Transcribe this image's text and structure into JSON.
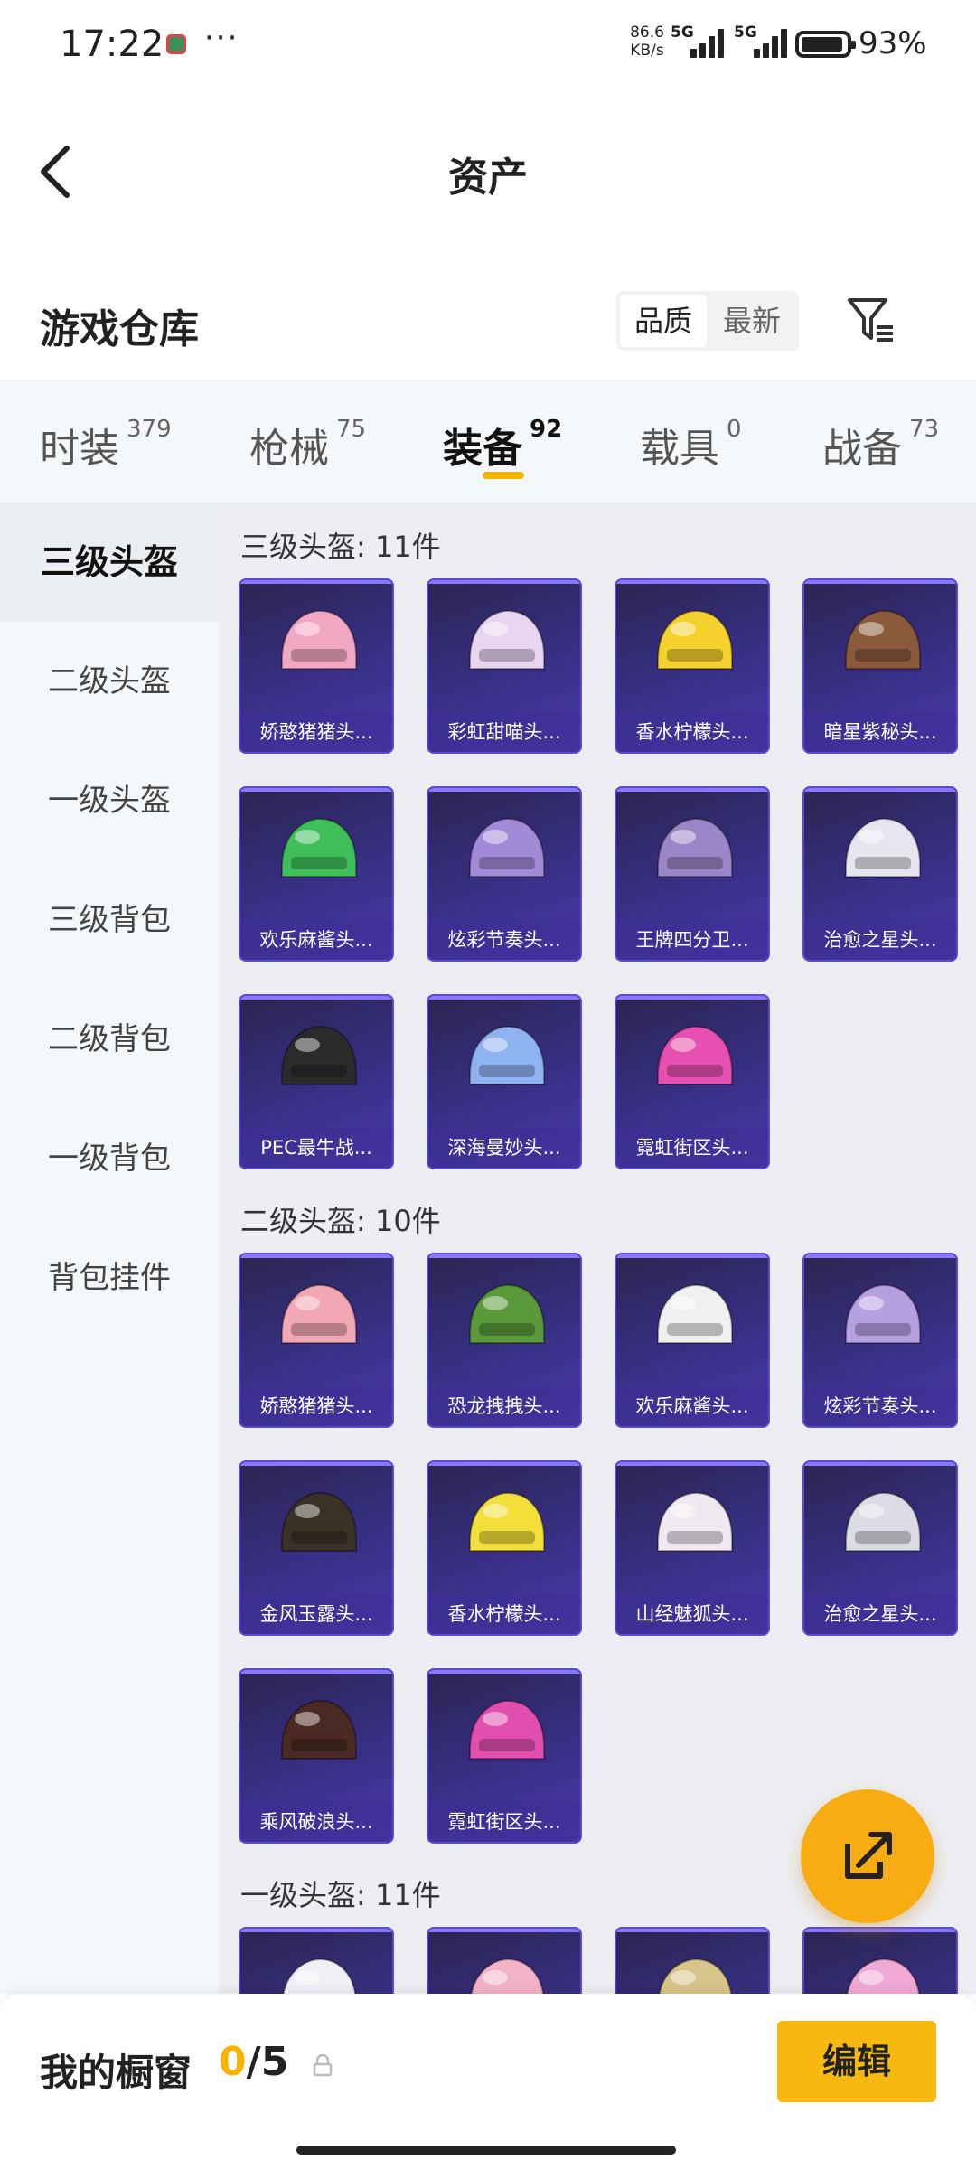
{
  "status_bar": {
    "time": "17:22",
    "more": "···",
    "net_speed_value": "86.6",
    "net_speed_unit": "KB/s",
    "signal1": "5G",
    "signal2": "5G",
    "battery": "93%"
  },
  "header": {
    "title": "资产"
  },
  "warehouse": {
    "title": "游戏仓库",
    "sort_quality": "品质",
    "sort_newest": "最新"
  },
  "tabs": [
    {
      "label": "时装",
      "count": "379",
      "active": false
    },
    {
      "label": "枪械",
      "count": "75",
      "active": false
    },
    {
      "label": "装备",
      "count": "92",
      "active": true
    },
    {
      "label": "载具",
      "count": "0",
      "active": false
    },
    {
      "label": "战备",
      "count": "73",
      "active": false
    }
  ],
  "sidebar": {
    "items": [
      {
        "label": "三级头盔",
        "active": true
      },
      {
        "label": "二级头盔",
        "active": false
      },
      {
        "label": "一级头盔",
        "active": false
      },
      {
        "label": "三级背包",
        "active": false
      },
      {
        "label": "二级背包",
        "active": false
      },
      {
        "label": "一级背包",
        "active": false
      },
      {
        "label": "背包挂件",
        "active": false
      }
    ]
  },
  "sections": [
    {
      "title": "三级头盔: 11件",
      "items": [
        {
          "name": "娇憨猪猪头...",
          "icon": "pink-pig-helmet-icon",
          "color": "#f2a7c3"
        },
        {
          "name": "彩虹甜喵头...",
          "icon": "rainbow-cat-helmet-icon",
          "color": "#e8d6f0"
        },
        {
          "name": "香水柠檬头...",
          "icon": "lemon-helmet-icon",
          "color": "#f5d12e"
        },
        {
          "name": "暗星紫秘头...",
          "icon": "dark-star-helmet-icon",
          "color": "#8a5a3a"
        },
        {
          "name": "欢乐麻酱头...",
          "icon": "mahjong-helmet-icon",
          "color": "#3fbf5a"
        },
        {
          "name": "炫彩节奏头...",
          "icon": "rhythm-helmet-icon",
          "color": "#a38ad8"
        },
        {
          "name": "王牌四分卫...",
          "icon": "quarterback-helmet-icon",
          "color": "#9b86c9"
        },
        {
          "name": "治愈之星头...",
          "icon": "healing-star-helmet-icon",
          "color": "#e6e6ee"
        },
        {
          "name": "PEC最牛战...",
          "icon": "pec-cow-helmet-icon",
          "color": "#2b2b2b"
        },
        {
          "name": "深海曼妙头...",
          "icon": "deep-sea-helmet-icon",
          "color": "#8fb3f0"
        },
        {
          "name": "霓虹街区头...",
          "icon": "neon-street-helmet-icon",
          "color": "#e74fb0"
        }
      ]
    },
    {
      "title": "二级头盔: 10件",
      "items": [
        {
          "name": "娇憨猪猪头...",
          "icon": "pink-pig-helmet-icon",
          "color": "#f2a7b5"
        },
        {
          "name": "恐龙拽拽头...",
          "icon": "dinosaur-helmet-icon",
          "color": "#5a9a3a"
        },
        {
          "name": "欢乐麻酱头...",
          "icon": "mahjong-helmet-icon",
          "color": "#f0f0f0"
        },
        {
          "name": "炫彩节奏头...",
          "icon": "rhythm-helmet-icon",
          "color": "#b6a0e0"
        },
        {
          "name": "金风玉露头...",
          "icon": "golden-wind-helmet-icon",
          "color": "#3a3226"
        },
        {
          "name": "香水柠檬头...",
          "icon": "lemon-helmet-icon",
          "color": "#f3df3a"
        },
        {
          "name": "山经魅狐头...",
          "icon": "fox-helmet-icon",
          "color": "#f0eaf0"
        },
        {
          "name": "治愈之星头...",
          "icon": "healing-star-helmet-icon",
          "color": "#dcdce4"
        },
        {
          "name": "乘风破浪头...",
          "icon": "wave-rider-helmet-icon",
          "color": "#4a2a22"
        },
        {
          "name": "霓虹街区头...",
          "icon": "neon-street-helmet-icon",
          "color": "#e24fae"
        }
      ]
    },
    {
      "title": "一级头盔: 11件",
      "items": [
        {
          "name": "",
          "icon": "white-helmet-icon",
          "color": "#eef0f5"
        },
        {
          "name": "",
          "icon": "pink-pig-helmet-icon",
          "color": "#f2b3c6"
        },
        {
          "name": "",
          "icon": "gold-helmet-icon",
          "color": "#d7c58a"
        },
        {
          "name": "",
          "icon": "pink-helmet-icon",
          "color": "#f0a8d4"
        }
      ]
    }
  ],
  "bottom_bar": {
    "showcase_label": "我的橱窗",
    "showcase_current": "0",
    "showcase_total": "/5",
    "edit_label": "编辑"
  },
  "colors": {
    "accent": "#f5b400",
    "card_bg": "#392f86",
    "card_border": "#5b4bd0"
  }
}
